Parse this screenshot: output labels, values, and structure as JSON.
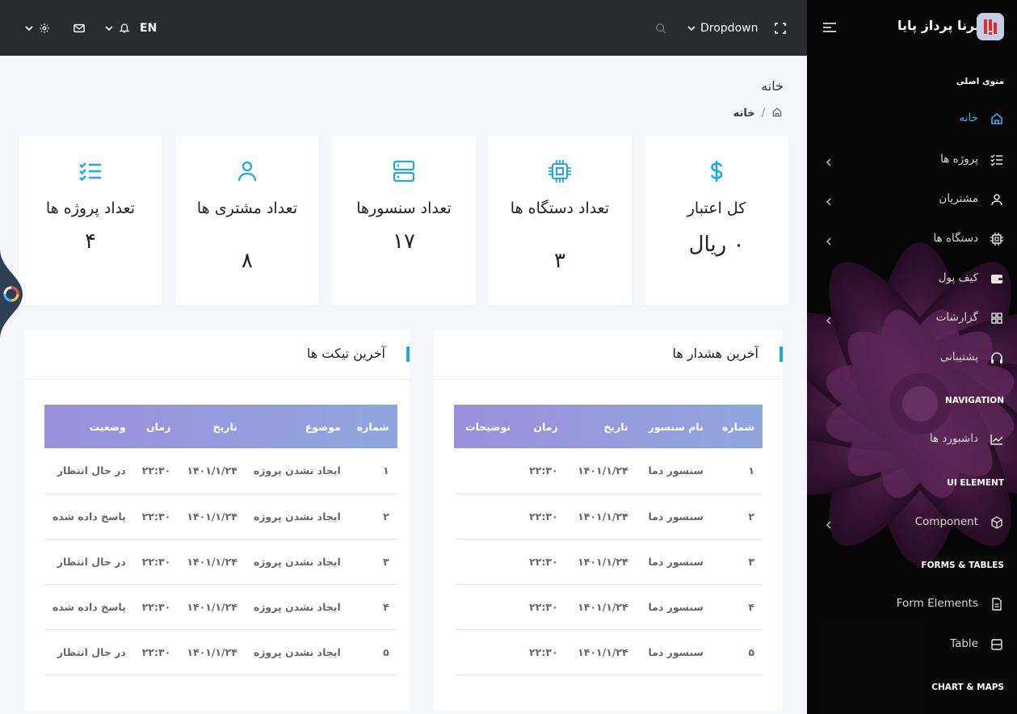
{
  "topbar": {
    "lang": "EN",
    "dropdown_label": "Dropdown"
  },
  "sidebar": {
    "brand": "برنا پرداز پایا",
    "section_main": "منوی اصلی",
    "items": [
      {
        "label": "خانه",
        "icon": "home-icon",
        "active": true
      },
      {
        "label": "پروژه ها",
        "icon": "checklist-icon"
      },
      {
        "label": "مشتریان",
        "icon": "user-icon"
      },
      {
        "label": "دستگاه ها",
        "icon": "chip-icon"
      },
      {
        "label": "کیف پول",
        "icon": "wallet-icon"
      },
      {
        "label": "گزارشات",
        "icon": "grid-icon"
      },
      {
        "label": "پشتیبانی",
        "icon": "headphones-icon"
      }
    ],
    "section_nav": "NAVIGATION",
    "dashboards": "داشبورد ها",
    "section_ui": "UI ELEMENT",
    "component": "Component",
    "section_forms": "FORMS & TABLES",
    "form_elements": "Form Elements",
    "table": "Table",
    "section_chart": "CHART & MAPS"
  },
  "page": {
    "title": "خانه",
    "breadcrumb": "خانه",
    "breadcrumb_sep": "/"
  },
  "cards": [
    {
      "label": "کل اعتبار",
      "value": "۰ ریال",
      "icon": "dollar-icon"
    },
    {
      "label": "تعداد دستگاه ها",
      "value": "۳",
      "icon": "chip-icon"
    },
    {
      "label": "تعداد سنسورها",
      "value": "۱۷",
      "icon": "server-icon"
    },
    {
      "label": "تعداد مشتری ها",
      "value": "۸",
      "icon": "user-icon"
    },
    {
      "label": "تعداد پروژه ها",
      "value": "۴",
      "icon": "checklist-icon"
    }
  ],
  "alerts": {
    "title": "آخرین هشدار ها",
    "headers": [
      "شماره",
      "نام سنسور",
      "تاریخ",
      "زمان",
      "توضیحات"
    ],
    "rows": [
      [
        "۱",
        "سنسور دما",
        "۱۴۰۱/۱/۲۴",
        "۲۲:۳۰",
        ""
      ],
      [
        "۲",
        "سنسور دما",
        "۱۴۰۱/۱/۲۴",
        "۲۲:۳۰",
        ""
      ],
      [
        "۳",
        "سنسور دما",
        "۱۴۰۱/۱/۲۴",
        "۲۲:۳۰",
        ""
      ],
      [
        "۴",
        "سنسور دما",
        "۱۴۰۱/۱/۲۴",
        "۲۲:۳۰",
        ""
      ],
      [
        "۵",
        "سنسور دما",
        "۱۴۰۱/۱/۲۴",
        "۲۲:۳۰",
        ""
      ]
    ]
  },
  "tickets": {
    "title": "آخرین تیکت ها",
    "headers": [
      "شماره",
      "موضوع",
      "تاریخ",
      "زمان",
      "وضعیت"
    ],
    "rows": [
      [
        "۱",
        "ایجاد نشدن پروژه",
        "۱۴۰۱/۱/۲۴",
        "۲۲:۳۰",
        "در حال انتظار"
      ],
      [
        "۲",
        "ایجاد نشدن پروژه",
        "۱۴۰۱/۱/۲۴",
        "۲۲:۳۰",
        "پاسخ داده شده"
      ],
      [
        "۳",
        "ایجاد نشدن پروژه",
        "۱۴۰۱/۱/۲۴",
        "۲۲:۳۰",
        "در حال انتظار"
      ],
      [
        "۴",
        "ایجاد نشدن پروژه",
        "۱۴۰۱/۱/۲۴",
        "۲۲:۳۰",
        "پاسخ داده شده"
      ],
      [
        "۵",
        "ایجاد نشدن پروژه",
        "۱۴۰۱/۱/۲۴",
        "۲۲:۳۰",
        "در حال انتظار"
      ]
    ],
    "status_colors": {
      "waiting": "#1a73d6",
      "answered": "#3b9b3b"
    }
  },
  "colors": {
    "accent": "#1ba7e9",
    "topbar": "#2a2b2d",
    "sidebar": "#0a0a0a"
  }
}
